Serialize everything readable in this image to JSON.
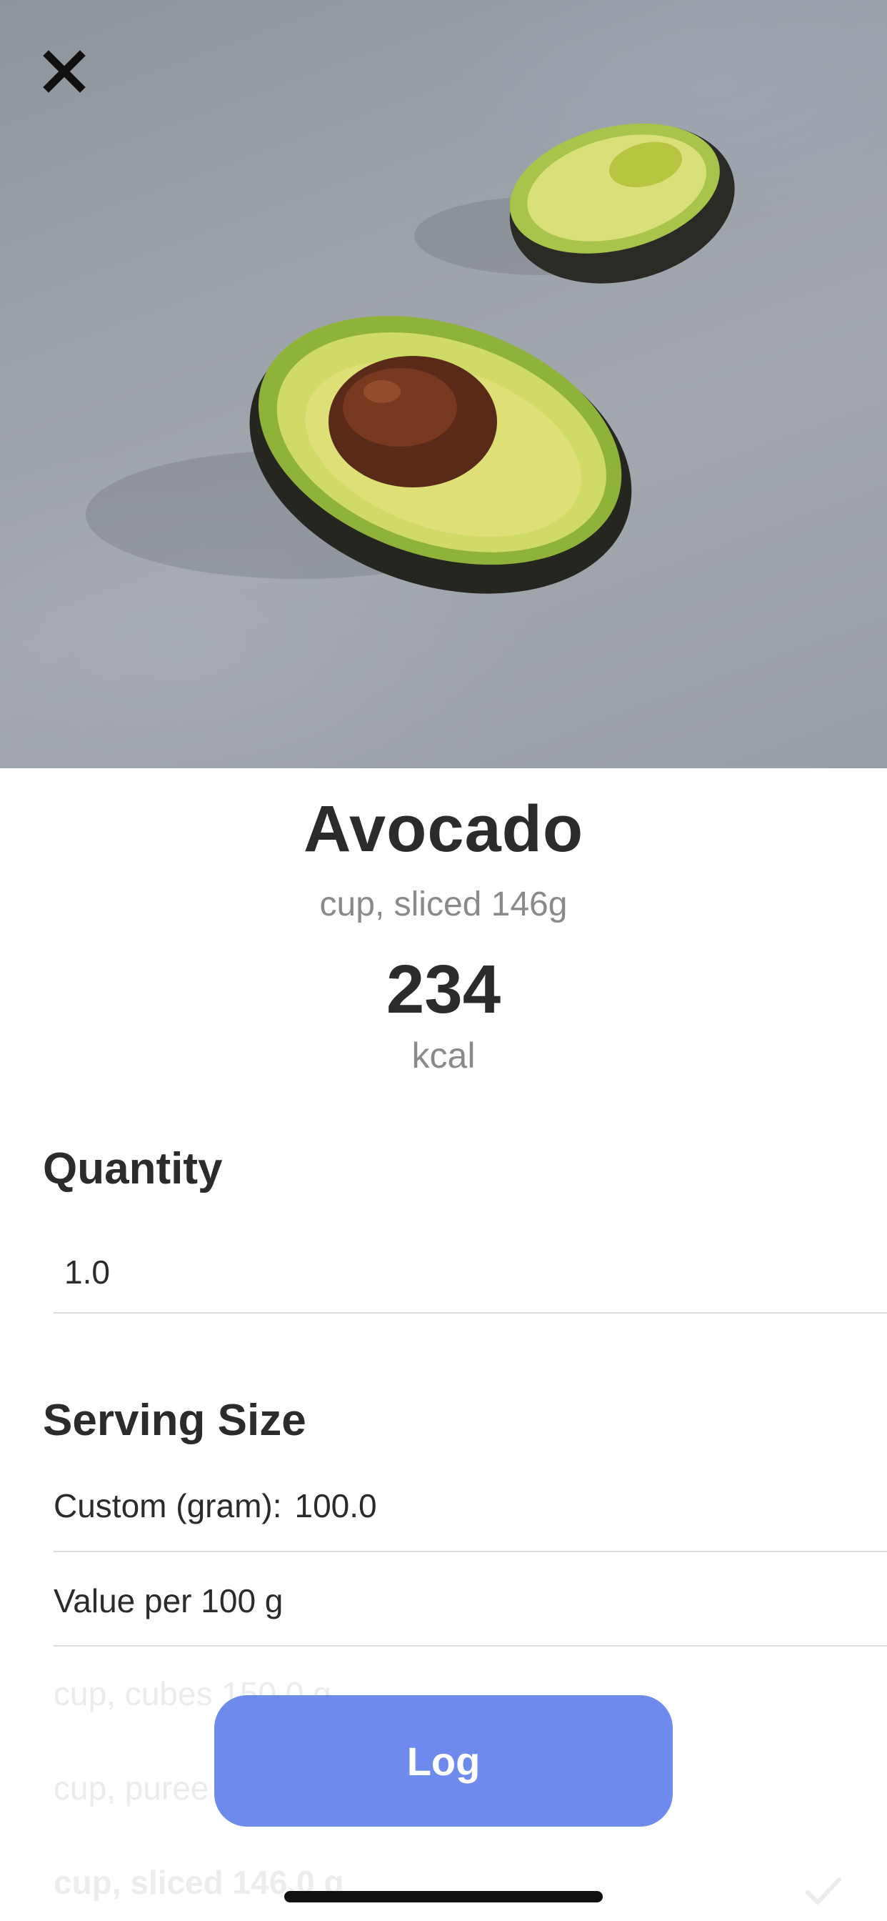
{
  "hero": {
    "image": "avocado-halves-photo",
    "close_icon": "close-icon"
  },
  "food": {
    "name": "Avocado",
    "serving": "cup, sliced 146g",
    "calories": "234",
    "calories_unit": "kcal"
  },
  "quantity": {
    "title": "Quantity",
    "value": "1.0"
  },
  "serving_size": {
    "title": "Serving Size",
    "custom_label": "Custom (gram):",
    "custom_value": "100.0",
    "options": [
      {
        "label": "Value per 100 g"
      },
      {
        "label": "cup, cubes 150.0 g"
      },
      {
        "label": "cup, puree 230.0 g"
      },
      {
        "label": "cup, sliced 146.0 g",
        "selected": true
      }
    ],
    "selected_icon": "checkmark-icon"
  },
  "actions": {
    "log_label": "Log"
  },
  "colors": {
    "accent": "#6d8aec",
    "text": "#2b2b2b",
    "secondary_text": "#8a8a8a"
  }
}
